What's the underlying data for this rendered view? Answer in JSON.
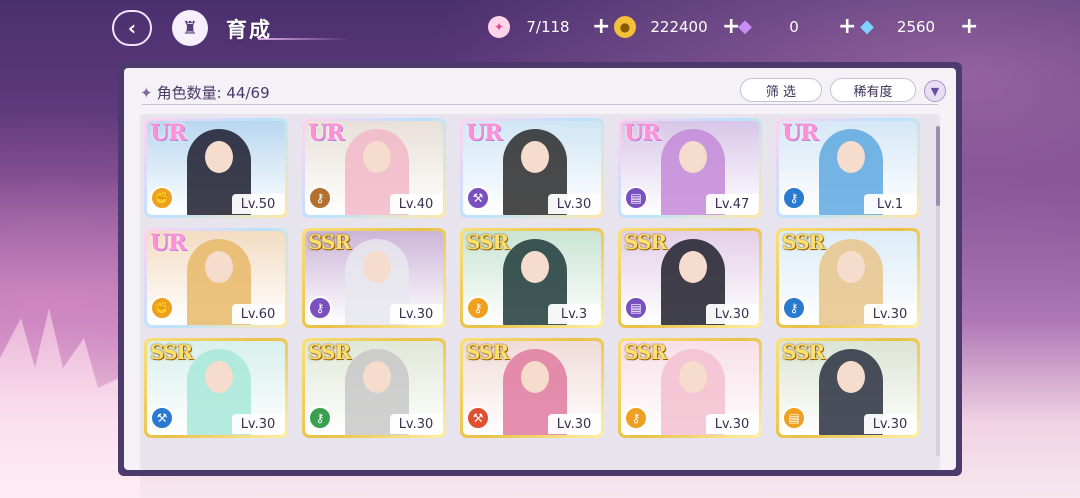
{
  "header": {
    "back_icon": "back-arrow-icon",
    "home_icon": "castle-home-icon",
    "title": "育成"
  },
  "resources": [
    {
      "name": "candy",
      "icon": "candy-icon",
      "value": "7/118"
    },
    {
      "name": "coin",
      "icon": "coin-icon",
      "value": "222400"
    },
    {
      "name": "pink-gem",
      "icon": "pink-diamond-icon",
      "value": "0"
    },
    {
      "name": "blue-gem",
      "icon": "blue-diamond-icon",
      "value": "2560"
    }
  ],
  "toolbar": {
    "count_label": "角色数量: 44/69",
    "filter_label": "筛 选",
    "rarity_label": "稀有度",
    "sort_icon": "sort-chevron-icon"
  },
  "characters": [
    {
      "rarity": "UR",
      "level": "Lv.50",
      "role": "fist",
      "role_color": "#f0a020",
      "bg": "#b8d7f0",
      "hair": "#1c1c2e"
    },
    {
      "rarity": "UR",
      "level": "Lv.40",
      "role": "key",
      "role_color": "#b07030",
      "bg": "#e8e0d8",
      "hair": "#f2b7c8"
    },
    {
      "rarity": "UR",
      "level": "Lv.30",
      "role": "hammer",
      "role_color": "#7a4fc0",
      "bg": "#d0e6f5",
      "hair": "#2a2a2a"
    },
    {
      "rarity": "UR",
      "level": "Lv.47",
      "role": "book",
      "role_color": "#7a4fc0",
      "bg": "#d8c6e8",
      "hair": "#c48ad8"
    },
    {
      "rarity": "UR",
      "level": "Lv.1",
      "role": "key",
      "role_color": "#2a7ad0",
      "bg": "#d6e8f6",
      "hair": "#5ea8e0"
    },
    {
      "rarity": "UR",
      "level": "Lv.60",
      "role": "fist",
      "role_color": "#f0a020",
      "bg": "#f3dcc2",
      "hair": "#e8b868"
    },
    {
      "rarity": "SSR",
      "level": "Lv.30",
      "role": "key",
      "role_color": "#7a4fc0",
      "bg": "#cbb5d8",
      "hair": "#e8e8ee"
    },
    {
      "rarity": "SSR",
      "level": "Lv.3",
      "role": "key",
      "role_color": "#f0a020",
      "bg": "#c9e4d4",
      "hair": "#1e3a3a"
    },
    {
      "rarity": "SSR",
      "level": "Lv.30",
      "role": "book",
      "role_color": "#7a4fc0",
      "bg": "#e4cfe8",
      "hair": "#1e1e2a"
    },
    {
      "rarity": "SSR",
      "level": "Lv.30",
      "role": "key",
      "role_color": "#2a7ad0",
      "bg": "#dcecf6",
      "hair": "#e8c48a"
    },
    {
      "rarity": "SSR",
      "level": "Lv.30",
      "role": "hammer",
      "role_color": "#2a7ad0",
      "bg": "#d8f0ec",
      "hair": "#a8e8d8"
    },
    {
      "rarity": "SSR",
      "level": "Lv.30",
      "role": "key",
      "role_color": "#3aa050",
      "bg": "#e0e8d8",
      "hair": "#c8c8c8"
    },
    {
      "rarity": "SSR",
      "level": "Lv.30",
      "role": "hammer",
      "role_color": "#e05030",
      "bg": "#f0dcd8",
      "hair": "#e07aa0"
    },
    {
      "rarity": "SSR",
      "level": "Lv.30",
      "role": "key",
      "role_color": "#f0a020",
      "bg": "#f8dfe8",
      "hair": "#f3c0d0"
    },
    {
      "rarity": "SSR",
      "level": "Lv.30",
      "role": "book",
      "role_color": "#f0a020",
      "bg": "#dce4d4",
      "hair": "#2a3040"
    }
  ],
  "colors": {
    "panel_frame": "#4b3a6b",
    "panel_bg": "#f4f2f6",
    "ur_frame": "#ffd2f0",
    "ssr_frame": "#f9e07a"
  }
}
